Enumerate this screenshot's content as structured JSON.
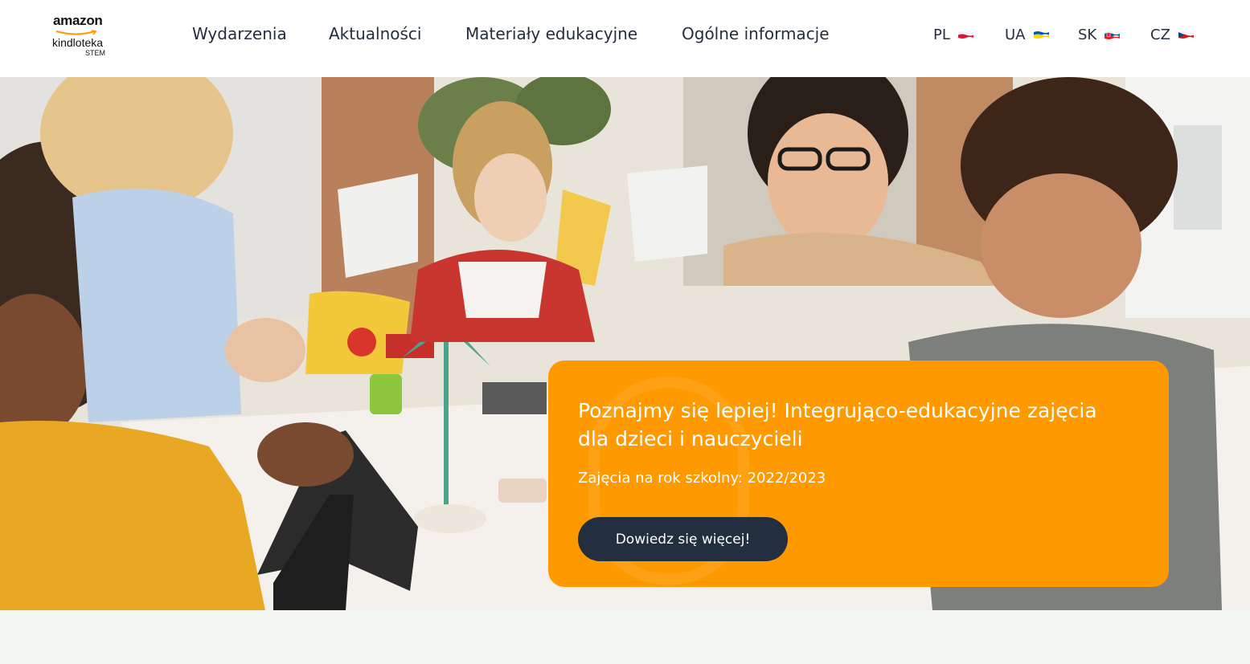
{
  "logo": {
    "amazon": "amazon",
    "kindl": "kindloteka",
    "stem": "STEM"
  },
  "nav": {
    "items": [
      {
        "label": "Wydarzenia"
      },
      {
        "label": "Aktualności"
      },
      {
        "label": "Materiały edukacyjne"
      },
      {
        "label": "Ogólne informacje"
      }
    ]
  },
  "languages": [
    {
      "code": "PL",
      "flag": "poland-flag-icon"
    },
    {
      "code": "UA",
      "flag": "ukraine-flag-icon"
    },
    {
      "code": "SK",
      "flag": "slovakia-flag-icon"
    },
    {
      "code": "CZ",
      "flag": "czech-flag-icon"
    }
  ],
  "hero": {
    "image": "children-and-teacher-robotics-class-photo",
    "title": "Poznajmy się lepiej! Integrująco-edukacyjne zajęcia dla dzieci i nauczycieli",
    "subtitle": "Zajęcia na rok szkolny: 2022/2023",
    "button_label": "Dowiedz się więcej!"
  },
  "colors": {
    "accent": "#ff9900",
    "dark": "#232f3e",
    "header_bg": "#ffffff"
  }
}
